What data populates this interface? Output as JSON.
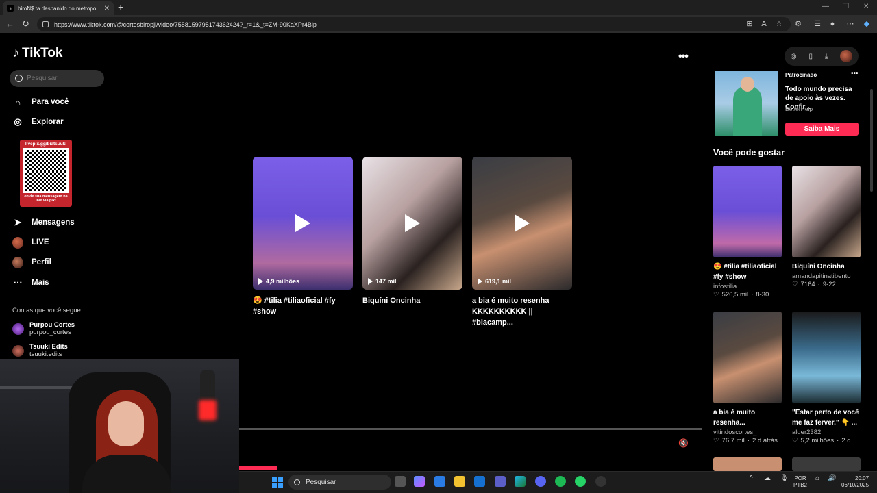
{
  "browser": {
    "tab_title": "biroN$ ta desbanido do metropo",
    "url": "https://www.tiktok.com/@cortesbiropjl/video/7558159795174362424?_r=1&_t=ZM-90KaXPr4Blp"
  },
  "sidebar": {
    "logo_text": "TikTok",
    "search_placeholder": "Pesquisar",
    "items": [
      {
        "label": "Para você",
        "icon": "home-icon"
      },
      {
        "label": "Explorar",
        "icon": "compass-icon"
      },
      {
        "label": "Mensagens",
        "icon": "message-icon"
      },
      {
        "label": "LIVE",
        "icon": "live-avatar-icon"
      },
      {
        "label": "Perfil",
        "icon": "profile-avatar-icon"
      },
      {
        "label": "Mais",
        "icon": "more-dots-icon"
      }
    ],
    "following_title": "Contas que você segue",
    "following": [
      {
        "name": "Purpou Cortes",
        "handle": "purpou_cortes"
      },
      {
        "name": "Tsuuki Edits",
        "handle": "tsuuki.edits"
      }
    ]
  },
  "overlay_qr": {
    "top": "livepix.gg/biatsuuki",
    "bottom": "envie sua mensagem na live via pix!"
  },
  "main": {
    "videos": [
      {
        "views": "4,9 milhões",
        "title": "😍 #tilia #tiliaoficial #fy #show"
      },
      {
        "views": "147 mil",
        "title": "Biquíni Oncinha"
      },
      {
        "views": "619,1 mil",
        "title": "a bia é muito resenha KKKKKKKKKK || #biacamp..."
      }
    ]
  },
  "ad": {
    "sponsored": "Patrocinado",
    "text": "Todo mundo precisa de apoio às vezes. Confir...",
    "brand": "BetterHelp",
    "cta": "Saiba Mais"
  },
  "suggestions": {
    "title": "Você pode gostar",
    "items": [
      {
        "title": "😍 #tilia #tiliaoficial #fy #show",
        "author": "infostilia",
        "likes": "526,5 mil",
        "date": "8-30"
      },
      {
        "title": "Biquíni Oncinha",
        "author": "amandapitinatibento",
        "likes": "7164",
        "date": "9-22"
      },
      {
        "title": "a bia é muito resenha...",
        "author": "vitindoscortes_",
        "likes": "76,7 mil",
        "date": "2 d atrás"
      },
      {
        "title": "\"Estar perto de você me faz ferver.\" 👇 ...",
        "author": "alger2382",
        "likes": "5,2 milhões",
        "date": "2 d..."
      }
    ]
  },
  "taskbar": {
    "search": "Pesquisar",
    "lang": "POR",
    "layout": "PTB2",
    "time": "20:07",
    "date": "06/10/2025"
  }
}
